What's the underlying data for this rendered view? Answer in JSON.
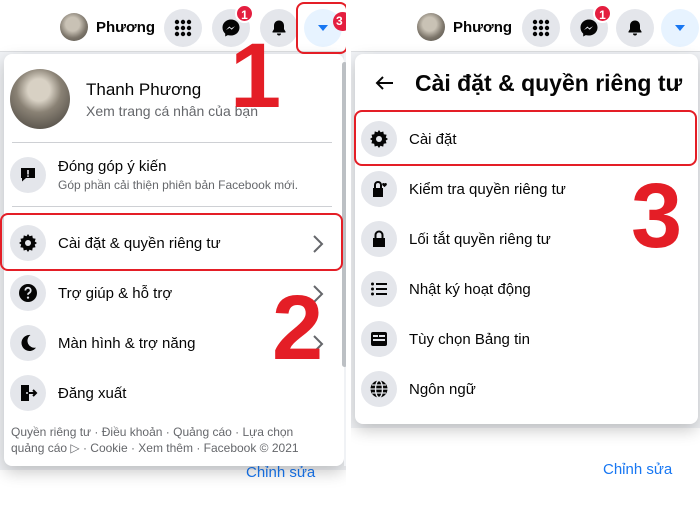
{
  "left": {
    "profile_chip": "Phương",
    "notification_count": "1",
    "partial_badge": "3",
    "menu": {
      "profile": {
        "name": "Thanh Phương",
        "subtitle": "Xem trang cá nhân của bạn"
      },
      "feedback": {
        "title": "Đóng góp ý kiến",
        "subtitle": "Góp phần cải thiện phiên bản Facebook mới."
      },
      "items": [
        {
          "label": "Cài đặt & quyền riêng tư",
          "icon": "gear-icon"
        },
        {
          "label": "Trợ giúp & hỗ trợ",
          "icon": "question-icon"
        },
        {
          "label": "Màn hình & trợ năng",
          "icon": "moon-icon"
        },
        {
          "label": "Đăng xuất",
          "icon": "logout-icon"
        }
      ],
      "footer_line1": "Quyền riêng tư · Điều khoản · Quảng cáo · Lựa chọn",
      "footer_line2": "quảng cáo ▷ · Cookie · Xem thêm · Facebook © 2021"
    },
    "background_link": "Chỉnh sửa"
  },
  "right": {
    "profile_chip": "Phương",
    "notification_count": "1",
    "menu": {
      "title": "Cài đặt & quyền riêng tư",
      "items": [
        {
          "label": "Cài đặt",
          "icon": "gear-icon"
        },
        {
          "label": "Kiểm tra quyền riêng tư",
          "icon": "lock-heart-icon"
        },
        {
          "label": "Lối tắt quyền riêng tư",
          "icon": "lock-icon"
        },
        {
          "label": "Nhật ký hoạt động",
          "icon": "list-icon"
        },
        {
          "label": "Tùy chọn Bảng tin",
          "icon": "news-feed-icon"
        },
        {
          "label": "Ngôn ngữ",
          "icon": "globe-icon"
        }
      ]
    },
    "background_link": "Chỉnh sửa"
  },
  "annotations": {
    "step1": "1",
    "step2": "2",
    "step3": "3"
  },
  "colors": {
    "accent": "#1877f2",
    "highlight": "#e41e26",
    "badge": "#e41e3f"
  }
}
